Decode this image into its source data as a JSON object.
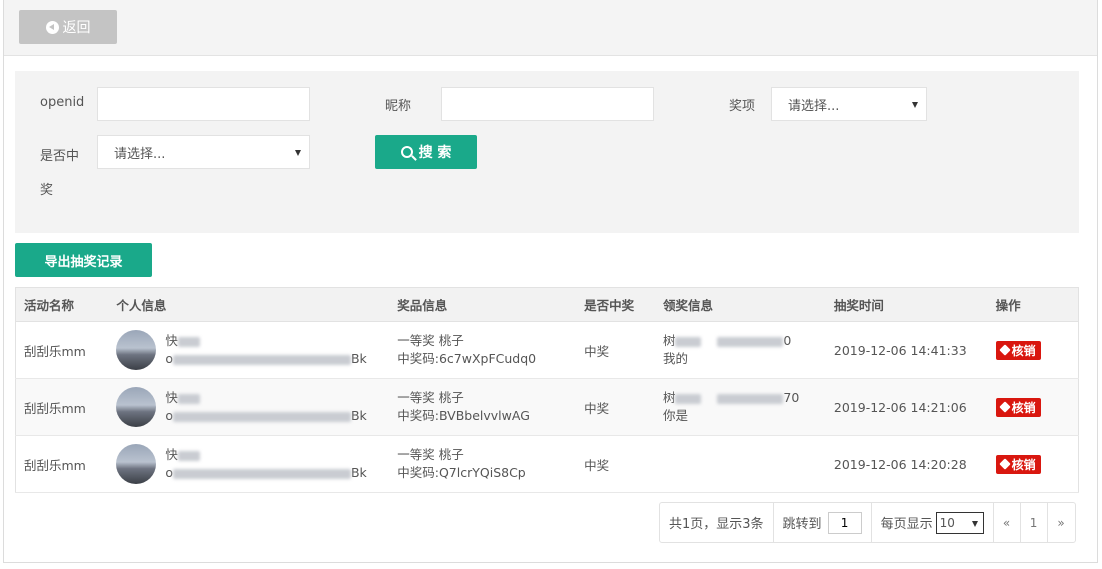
{
  "toolbar": {
    "back_label": "返回"
  },
  "filters": {
    "openid_label": "openid",
    "openid_value": "",
    "nickname_label": "昵称",
    "nickname_value": "",
    "prize_label": "奖项",
    "prize_selected": "请选择...",
    "won_label_line1": "是否中",
    "won_label_line2": "奖",
    "won_selected": "请选择...",
    "search_label": "搜 索"
  },
  "export_label": "导出抽奖记录",
  "table": {
    "headers": [
      "活动名称",
      "个人信息",
      "奖品信息",
      "是否中奖",
      "领奖信息",
      "抽奖时间",
      "操作"
    ],
    "rows": [
      {
        "activity": "刮刮乐mm",
        "nickname_prefix": "快",
        "openid_prefix": "o",
        "openid_suffix": "Bk",
        "prize": "一等奖 桃子",
        "code_label": "中奖码:",
        "code": "6c7wXpFCudq0",
        "won": "中奖",
        "claim_name_prefix": "树",
        "claim_phone_suffix": "0",
        "claim_note": "我的",
        "time": "2019-12-06 14:41:33",
        "action": "核销"
      },
      {
        "activity": "刮刮乐mm",
        "nickname_prefix": "快",
        "openid_prefix": "o",
        "openid_suffix": "Bk",
        "prize": "一等奖 桃子",
        "code_label": "中奖码:",
        "code": "BVBbelvvlwAG",
        "won": "中奖",
        "claim_name_prefix": "树",
        "claim_phone_suffix": "70",
        "claim_note": "你是",
        "time": "2019-12-06 14:21:06",
        "action": "核销"
      },
      {
        "activity": "刮刮乐mm",
        "nickname_prefix": "快",
        "openid_prefix": "o",
        "openid_suffix": "Bk",
        "prize": "一等奖 桃子",
        "code_label": "中奖码:",
        "code": "Q7lcrYQiS8Cp",
        "won": "中奖",
        "claim_name_prefix": "",
        "claim_phone_suffix": "",
        "claim_note": "",
        "time": "2019-12-06 14:20:28",
        "action": "核销"
      }
    ]
  },
  "pagination": {
    "summary": "共1页，显示3条",
    "jump_label": "跳转到",
    "jump_value": "1",
    "per_page_label": "每页显示",
    "per_page_value": "10",
    "prev": "«",
    "current": "1",
    "next": "»"
  },
  "colors": {
    "primary": "#1aa98a",
    "danger": "#d9170f",
    "back_button": "#c4c4c4"
  }
}
